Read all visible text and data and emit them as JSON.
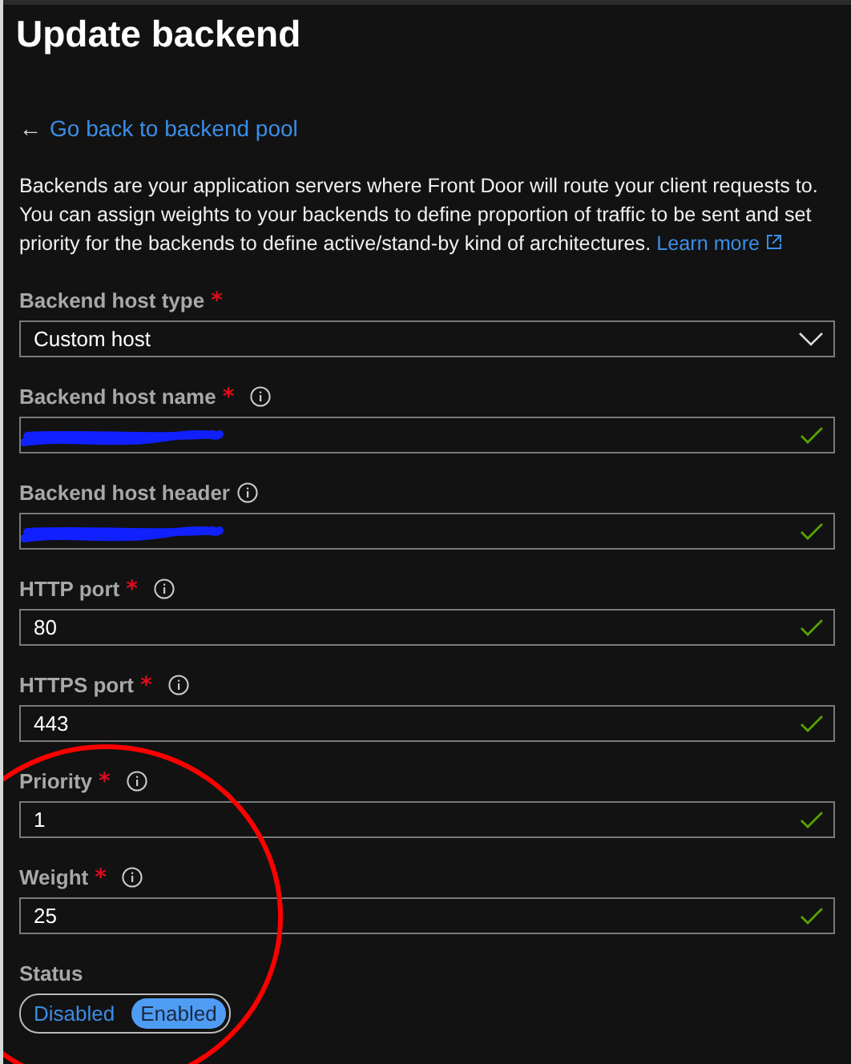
{
  "title": "Update backend",
  "back_link": {
    "arrow": "←",
    "label": "Go back to backend pool"
  },
  "description": "Backends are your application servers where Front Door will route your client requests to. You can assign weights to your backends to define proportion of traffic to be sent and set priority for the backends to define active/stand-by kind of architectures.",
  "learn_more_link": "Learn more",
  "fields": [
    {
      "kind": "select",
      "label": "Backend host type",
      "required_mark": "*",
      "value": "Custom host"
    },
    {
      "kind": "text",
      "label": "Backend host name",
      "required_mark": "*",
      "info": true,
      "redacted": true,
      "valid": true
    },
    {
      "kind": "text",
      "label": "Backend host header",
      "info": true,
      "redacted": true,
      "valid": true
    },
    {
      "kind": "text",
      "label": "HTTP port",
      "required_mark": "*",
      "info": true,
      "value": "80",
      "valid": true
    },
    {
      "kind": "text",
      "label": "HTTPS port",
      "required_mark": "*",
      "info": true,
      "value": "443",
      "valid": true
    },
    {
      "kind": "text",
      "label": "Priority",
      "required_mark": "*",
      "info": true,
      "value": "1",
      "valid": true
    },
    {
      "kind": "text",
      "label": "Weight",
      "required_mark": "*",
      "info": true,
      "value": "25",
      "valid": true
    },
    {
      "kind": "toggle",
      "label": "Status",
      "options": [
        {
          "label": "Disabled",
          "selected": false
        },
        {
          "label": "Enabled",
          "selected": true
        }
      ]
    }
  ],
  "annotations": [
    {
      "kind": "circle"
    }
  ]
}
